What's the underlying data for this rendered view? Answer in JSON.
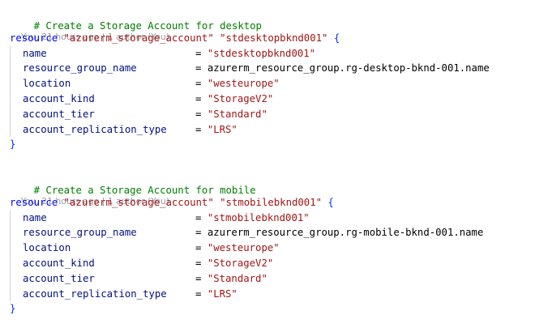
{
  "blocks": [
    {
      "comment": "# Create a Storage Account for desktop",
      "blame": "You, 21 hours ago | 1 author (You)",
      "keyword": "resource",
      "type": "\"azurerm_storage_account\"",
      "name": "\"stdesktopbknd001\"",
      "open_brace": "{",
      "close_brace": "}",
      "attributes": [
        {
          "key": "name",
          "value": "\"stdesktopbknd001\""
        },
        {
          "key": "resource_group_name",
          "value": "azurerm_resource_group.rg-desktop-bknd-001.name"
        },
        {
          "key": "location",
          "value": "\"westeurope\""
        },
        {
          "key": "account_kind",
          "value": "\"StorageV2\""
        },
        {
          "key": "account_tier",
          "value": "\"Standard\""
        },
        {
          "key": "account_replication_type",
          "value": "\"LRS\""
        }
      ]
    },
    {
      "comment": "# Create a Storage Account for mobile",
      "blame": "You, 21 hours ago | 1 author (You)",
      "keyword": "resource",
      "type": "\"azurerm_storage_account\"",
      "name": "\"stmobilebknd001\"",
      "open_brace": "{",
      "close_brace": "}",
      "attributes": [
        {
          "key": "name",
          "value": "\"stmobilebknd001\""
        },
        {
          "key": "resource_group_name",
          "value": "azurerm_resource_group.rg-mobile-bknd-001.name"
        },
        {
          "key": "location",
          "value": "\"westeurope\""
        },
        {
          "key": "account_kind",
          "value": "\"StorageV2\""
        },
        {
          "key": "account_tier",
          "value": "\"Standard\""
        },
        {
          "key": "account_replication_type",
          "value": "\"LRS\""
        }
      ]
    }
  ],
  "assign_op": "=",
  "colors": {
    "comment": "#008000",
    "keyword": "#0000ff",
    "string": "#a31515",
    "identifier": "#001080",
    "brace": "#0431fa",
    "blame": "#959da5"
  }
}
